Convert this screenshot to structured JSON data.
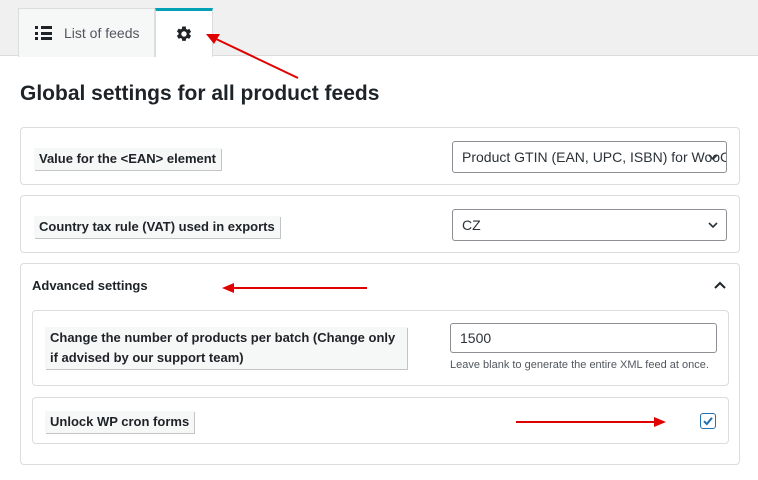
{
  "tabs": {
    "list_label": "List of feeds"
  },
  "page": {
    "title": "Global settings for all product feeds"
  },
  "ean": {
    "label": "Value for the <EAN> element",
    "selected": "Product GTIN (EAN, UPC, ISBN) for WooCommerce"
  },
  "vat": {
    "label": "Country tax rule (VAT) used in exports",
    "selected": "CZ"
  },
  "advanced": {
    "heading": "Advanced settings",
    "batch": {
      "label": "Change the number of products per batch (Change only if advised by our support team)",
      "value": "1500",
      "hint": "Leave blank to generate the entire XML feed at once."
    },
    "cron": {
      "label": "Unlock WP cron forms",
      "checked": true
    }
  },
  "colors": {
    "accent": "#00a0b5",
    "annotation": "#e00000",
    "checkbox": "#2271b1"
  },
  "icons": {
    "list": "list-icon",
    "settings": "gear-icon",
    "dropdown": "chevron-down-icon",
    "collapse": "chevron-up-icon",
    "check": "check-icon"
  }
}
